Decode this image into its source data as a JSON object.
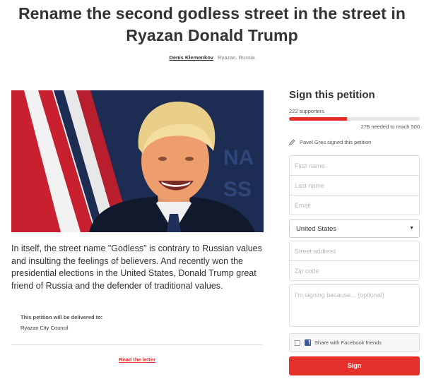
{
  "petition": {
    "title": "Rename the second godless street in the street in Ryazan Donald Trump",
    "author": "Denis Klemenkov",
    "location": "Ryazan, Russia",
    "description": "In itself, the street name \"Godless\" is contrary to Russian values and insulting the feelings of believers. And recently won the presidential elections in the United States, Donald Trump great friend of Russia and the defender of traditional values.",
    "delivered_label": "This petition will be delivered to:",
    "delivered_to": "Ryazan City Council",
    "read_letter": "Read the letter"
  },
  "sign_panel": {
    "title": "Sign this petition",
    "supporters_text": "222 supporters",
    "progress_fraction": 0.444,
    "needed_text": "278 needed to reach 500",
    "recent_signer": "Pavel Gres signed this petition",
    "first_name_placeholder": "First name",
    "last_name_placeholder": "Last name",
    "email_placeholder": "Email",
    "country_value": "United States",
    "street_placeholder": "Street address",
    "zip_placeholder": "Zip code",
    "reason_placeholder": "I'm signing because... (optional)",
    "facebook_share_label": "Share with Facebook friends",
    "sign_button": "Sign"
  },
  "colors": {
    "accent": "#e5302c",
    "facebook": "#3b5998"
  }
}
